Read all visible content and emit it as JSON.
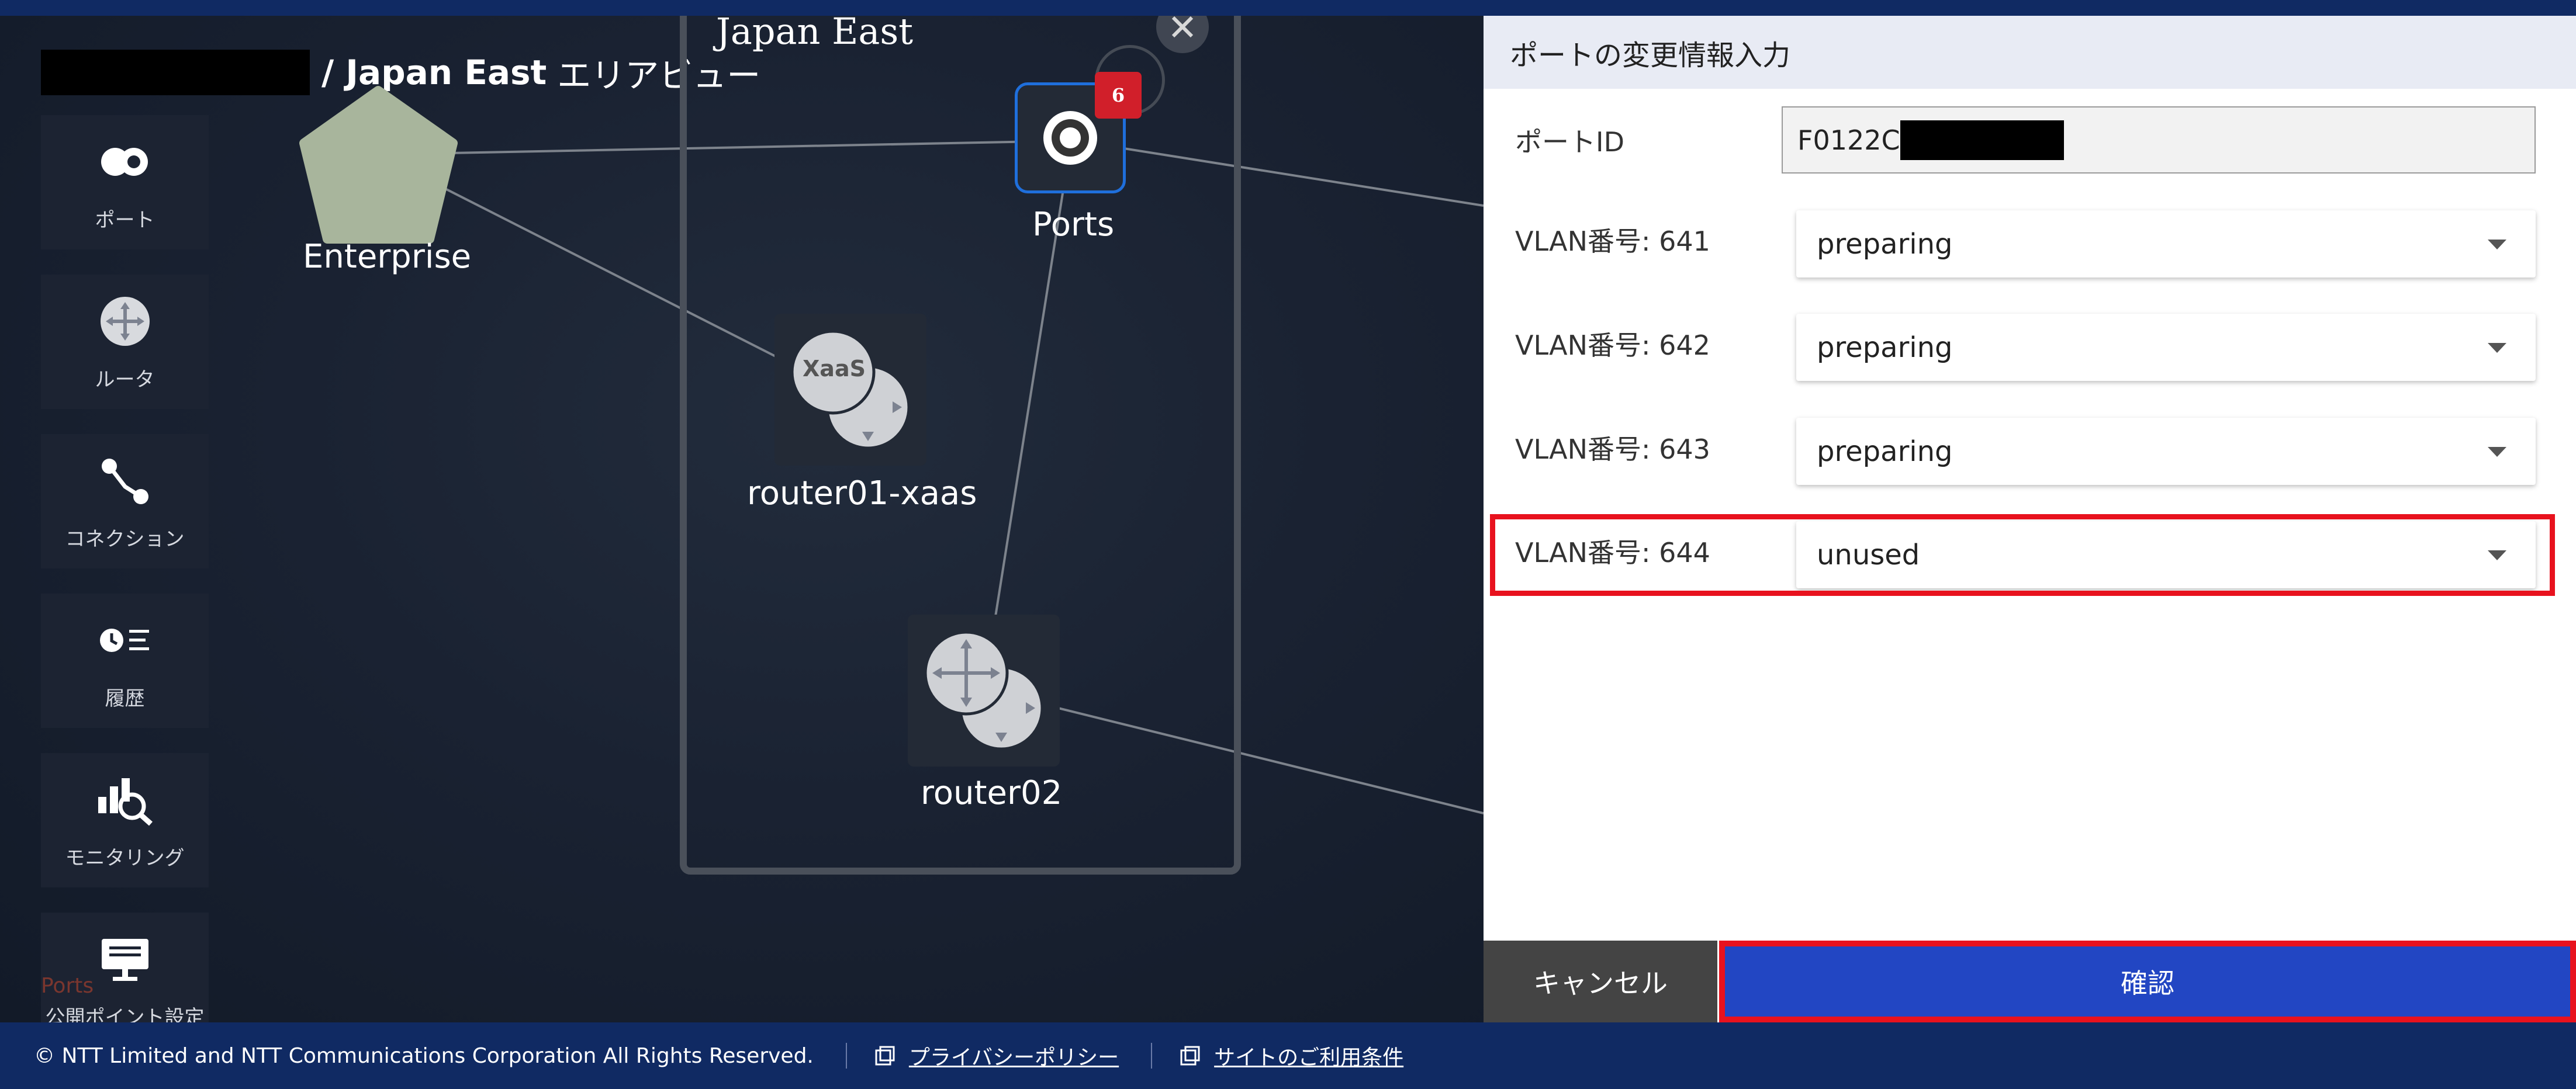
{
  "breadcrumb": {
    "area": "/ Japan East",
    "suffix": "エリアビュー"
  },
  "sidebar": {
    "items": [
      {
        "label": "ポート",
        "icon": "ports-icon"
      },
      {
        "label": "ルータ",
        "icon": "router-icon"
      },
      {
        "label": "コネクション",
        "icon": "connection-icon"
      },
      {
        "label": "履歴",
        "icon": "history-icon"
      },
      {
        "label": "モニタリング",
        "icon": "monitoring-icon"
      },
      {
        "label": "公開ポイント設定",
        "icon": "public-point-icon"
      }
    ],
    "ghost_label": "Ports"
  },
  "topology": {
    "zone_title": "Japan East",
    "nodes": {
      "enterprise": "Enterprise",
      "ports": "Ports",
      "router_xaas": "router01-xaas",
      "router02": "router02",
      "xaas_text": "XaaS"
    },
    "ports_badge": "6"
  },
  "panel": {
    "title": "ポートの変更情報入力",
    "port_id_label": "ポートID",
    "port_id_value": "F0122C",
    "vlans": [
      {
        "label": "VLAN番号: 641",
        "value": "preparing"
      },
      {
        "label": "VLAN番号: 642",
        "value": "preparing"
      },
      {
        "label": "VLAN番号: 643",
        "value": "preparing"
      },
      {
        "label": "VLAN番号: 644",
        "value": "unused"
      }
    ],
    "cancel_label": "キャンセル",
    "confirm_label": "確認"
  },
  "footer": {
    "copyright": "© NTT Limited and NTT Communications Corporation All Rights Reserved.",
    "privacy": "プライバシーポリシー",
    "terms": "サイトのご利用条件"
  },
  "colors": {
    "accent": "#2246c3",
    "header": "#102a63",
    "highlight": "#e8121e",
    "badge": "#d11f2a"
  }
}
